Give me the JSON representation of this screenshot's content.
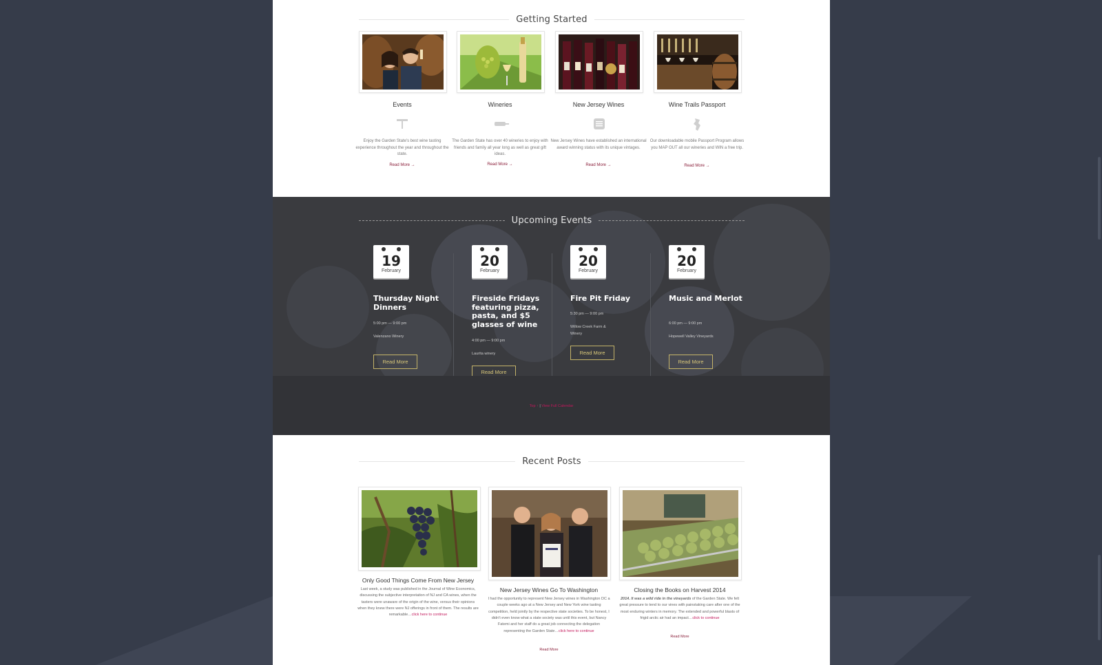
{
  "getting_started": {
    "title": "Getting Started",
    "cards": [
      {
        "title": "Events",
        "icon": "corkscrew-icon",
        "desc": "Enjoy the Garden State's best wine tasting experience throughout the year and throughout the state.",
        "link": "Read More →"
      },
      {
        "title": "Wineries",
        "icon": "wine-bottle-icon",
        "desc": "The Garden State has over 40 wineries to enjoy with friends and family all year long as well as great gift ideas.",
        "link": "Read More →"
      },
      {
        "title": "New Jersey Wines",
        "icon": "wine-label-icon",
        "desc": "New Jersey Wines have established an international award winning status with its unique vintages.",
        "link": "Read More →"
      },
      {
        "title": "Wine Trails Passport",
        "icon": "new-jersey-map-icon",
        "desc": "Our downloadable mobile Passport Program allows you MAP OUT all our wineries and WIN a free trip.",
        "link": "Read More →"
      }
    ]
  },
  "upcoming_events": {
    "title": "Upcoming Events",
    "events": [
      {
        "day": "19",
        "month": "February",
        "title": "Thursday Night Dinners",
        "time": "5:00 pm — 9:00 pm",
        "venue": "Valenzano Winery",
        "button": "Read More"
      },
      {
        "day": "20",
        "month": "February",
        "title": "Fireside Fridays featuring pizza, pasta, and $5 glasses of wine",
        "time": "4:00 pm — 9:00 pm",
        "venue": "Laurita winery",
        "button": "Read More"
      },
      {
        "day": "20",
        "month": "February",
        "title": "Fire Pit Friday",
        "time": "5:30 pm — 9:00 pm",
        "venue": "Willow Creek Farm & Winery",
        "button": "Read More"
      },
      {
        "day": "20",
        "month": "February",
        "title": "Music and Merlot",
        "time": "6:00 pm — 9:00 pm",
        "venue": "Hopewell Valley Vineyards",
        "button": "Read More"
      }
    ],
    "top_link": "Top ↑",
    "separator": "|",
    "calendar_link": "View Full Calendar"
  },
  "recent_posts": {
    "title": "Recent Posts",
    "posts": [
      {
        "title": "Only Good Things Come From New Jersey",
        "text": "Last week, a study was published in the Journal of Wine Economics, discussing the subjective interpretation of NJ and CA wines, when the tasters were unaware of the origin of the wine, versus their opinions when they knew there were NJ offerings in front of them. The results are remarkable…",
        "more": "click here to continue",
        "link": ""
      },
      {
        "title": "New Jersey Wines Go To Washington",
        "text": "I had the opportunity to represent New Jersey wines in Washington DC a couple weeks ago at a New Jersey and New York wine tasting competition, held jointly by the respective state societies. To be honest, I didn't even know what a state society was until this event, but Nancy Fatemi and her staff do a great job connecting the delegation representing the Garden State…",
        "more": "click here to continue",
        "link": "Read More"
      },
      {
        "title": "Closing the Books on Harvest 2014",
        "lead": "2014. It was a wild ride in the vineyards",
        "text": " of the Garden State. We felt great pressure to tend to our vines with painstaking care after one of the most enduring winters in memory. The extended and powerful blasts of frigid arctic air had an impact…",
        "more": "click to continue",
        "link": "Read More"
      }
    ]
  }
}
